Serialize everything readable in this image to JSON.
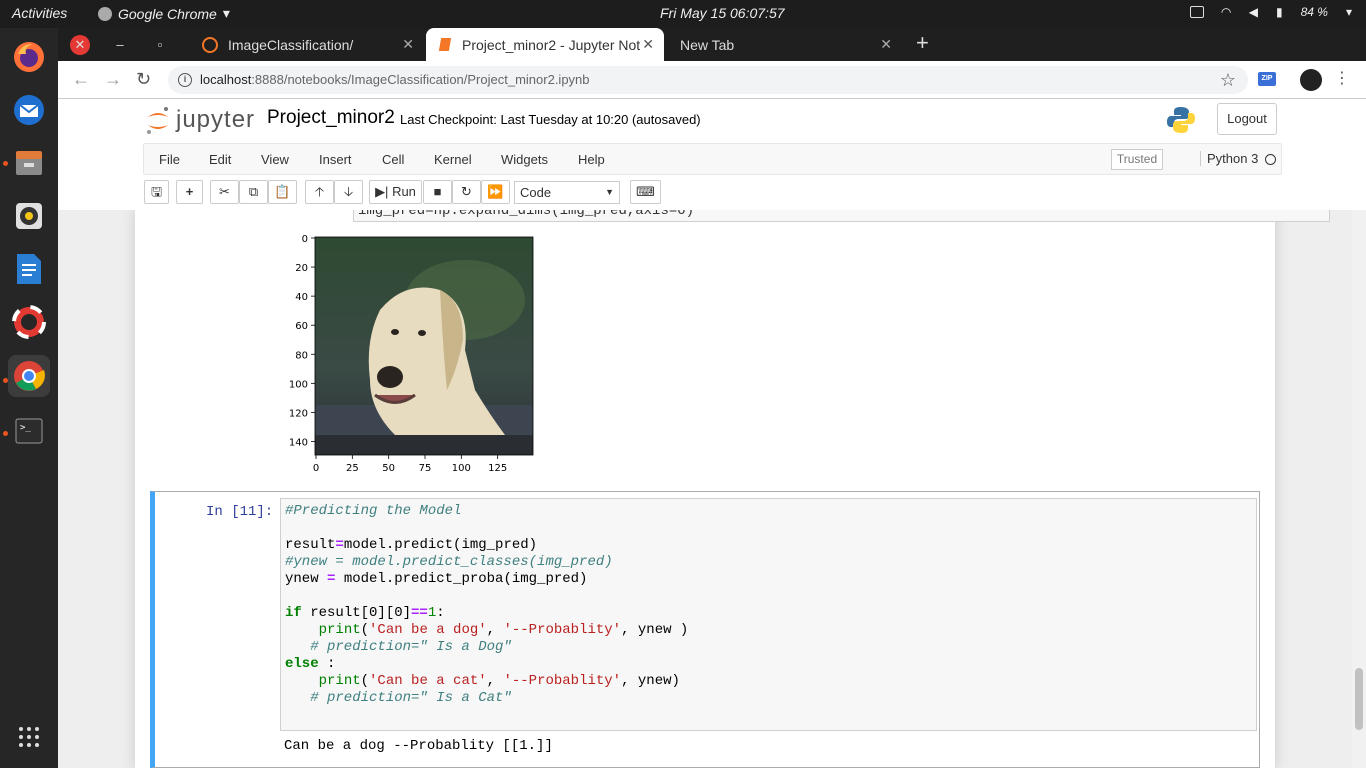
{
  "topbar": {
    "activities": "Activities",
    "app_name": "Google Chrome",
    "clock": "Fri May 15  06:07:57",
    "battery": "84 %"
  },
  "browser": {
    "tabs": [
      {
        "label": "ImageClassification/",
        "active": false
      },
      {
        "label": "Project_minor2 - Jupyter Noteb",
        "active": true
      },
      {
        "label": "New Tab",
        "active": false
      }
    ],
    "url_host": "localhost",
    "url_path": ":8888/notebooks/ImageClassification/Project_minor2.ipynb",
    "ext_label": "ZIP"
  },
  "jupyter": {
    "logo_text": "jupyter",
    "notebook_name": "Project_minor2",
    "checkpoint": "Last Checkpoint: Last Tuesday at 10:20   (autosaved)",
    "logout": "Logout",
    "menu": [
      "File",
      "Edit",
      "View",
      "Insert",
      "Cell",
      "Kernel",
      "Widgets",
      "Help"
    ],
    "trusted": "Trusted",
    "kernel_name": "Python 3",
    "run_label": "Run",
    "cell_type": "Code"
  },
  "prev_cell": {
    "input_partial": "img_pred=np.expand_dims(img_pred,axis=0)"
  },
  "chart_data": {
    "type": "image",
    "ytick_labels": [
      "0",
      "20",
      "40",
      "60",
      "80",
      "100",
      "120",
      "140"
    ],
    "xtick_labels": [
      "0",
      "25",
      "50",
      "75",
      "100",
      "125"
    ],
    "xlim": [
      0,
      150
    ],
    "ylim": [
      150,
      0
    ]
  },
  "cell": {
    "prompt": "In [11]:",
    "lines": [
      "#Predicting the Model",
      "",
      "result=model.predict(img_pred)",
      "#ynew = model.predict_classes(img_pred)",
      "ynew = model.predict_proba(img_pred)",
      "",
      "if result[0][0]==1:",
      "    print('Can be a dog', '--Probablity', ynew )",
      "   # prediction=\" Is a Dog\"",
      "else :",
      "    print('Can be a cat', '--Probablity', ynew)",
      "   # prediction=\" Is a Cat\""
    ],
    "output": "Can be a dog --Probablity [[1.]]"
  }
}
